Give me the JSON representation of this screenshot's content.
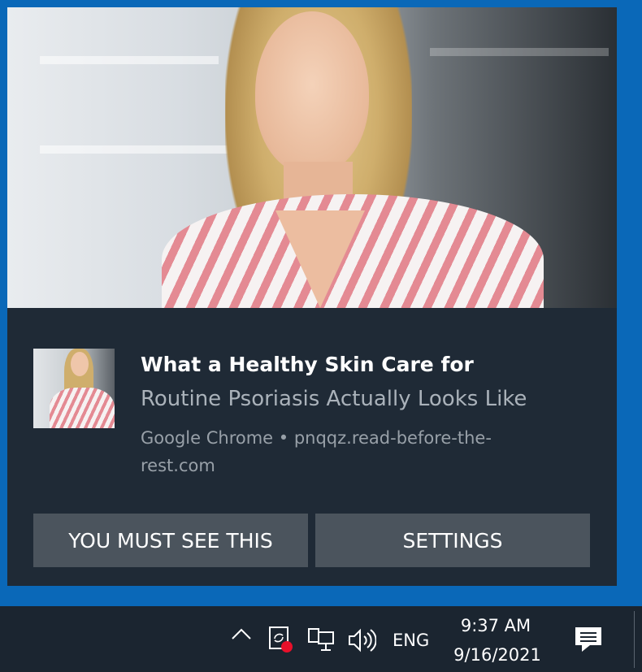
{
  "notification": {
    "title": "What a Healthy Skin Care for",
    "subtitle": "Routine Psoriasis Actually Looks Like",
    "source": "Google Chrome • pnqqz.read-before-the-rest.com",
    "buttons": [
      "YOU MUST SEE THIS",
      "SETTINGS"
    ]
  },
  "taskbar": {
    "language": "ENG",
    "time": "9:37 AM",
    "date": "9/16/2021",
    "icons": [
      "chevron-up-icon",
      "sync-alert-icon",
      "network-icon",
      "volume-icon",
      "notification-center-icon"
    ]
  },
  "colors": {
    "desktop": "#0a68b8",
    "toast": "#1f2a36",
    "button": "#4b545d",
    "taskbar": "#1b2530",
    "alert_dot": "#e8102a"
  }
}
